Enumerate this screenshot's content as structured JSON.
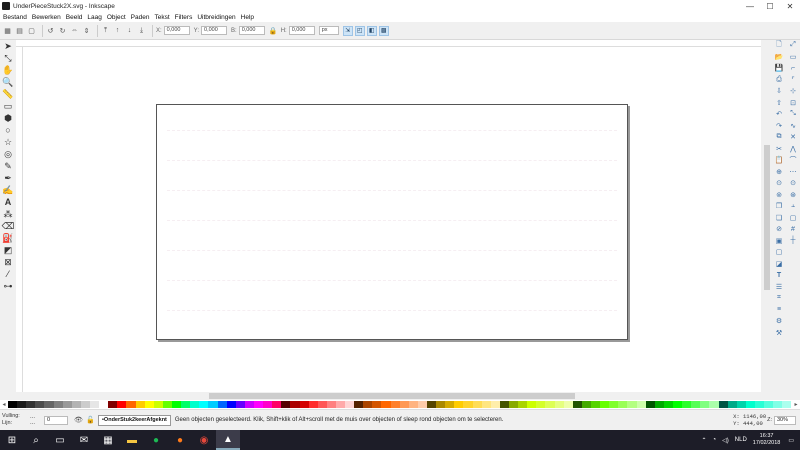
{
  "window": {
    "title": "UnderPieceStuck2X.svg - Inkscape",
    "minimize": "—",
    "maximize": "☐",
    "close": "✕"
  },
  "menu": [
    "Bestand",
    "Bewerken",
    "Beeld",
    "Laag",
    "Object",
    "Paden",
    "Tekst",
    "Filters",
    "Uitbreidingen",
    "Help"
  ],
  "toolcontrols": {
    "x_label": "X:",
    "x_value": "0,000",
    "y_label": "Y:",
    "y_value": "0,000",
    "w_label": "B:",
    "w_value": "0,000",
    "h_label": "H:",
    "h_value": "0,000",
    "unit": "px"
  },
  "statusbar": {
    "fill_label": "Vulling:",
    "stroke_label": "Lijn:",
    "fill_value": "...",
    "stroke_value": "...",
    "opacity": "0",
    "layer": "•OnderStuk2keerAfgeknt",
    "message": "Geen objecten geselecteerd. Klik, Shift+klik of Alt+scroll met de muis over objecten of sleep rond objecten om te selecteren.",
    "coord_x": "X: 1146,00",
    "coord_y": "Y:  444,00",
    "zoom_label": "Z:",
    "zoom": "30%"
  },
  "taskbar": {
    "language": "NLD",
    "time": "16:37",
    "date": "17/02/2018"
  },
  "palette_colors": [
    "#000000",
    "#1a1a1a",
    "#333333",
    "#4d4d4d",
    "#666666",
    "#808080",
    "#999999",
    "#b3b3b3",
    "#cccccc",
    "#e6e6e6",
    "#ffffff",
    "#800000",
    "#ff0000",
    "#ff6600",
    "#ffcc00",
    "#ffff00",
    "#ccff00",
    "#66ff00",
    "#00ff00",
    "#00ff66",
    "#00ffcc",
    "#00ffff",
    "#00ccff",
    "#0066ff",
    "#0000ff",
    "#6600ff",
    "#cc00ff",
    "#ff00ff",
    "#ff00cc",
    "#ff0066",
    "#550000",
    "#aa0000",
    "#d40000",
    "#ff2a2a",
    "#ff5555",
    "#ff8080",
    "#ffaaaa",
    "#ffd5d5",
    "#552200",
    "#aa4400",
    "#d45500",
    "#ff6600",
    "#ff7f2a",
    "#ff9955",
    "#ffb380",
    "#ffccaa",
    "#554400",
    "#aa8800",
    "#d4aa00",
    "#ffcc00",
    "#ffd42a",
    "#ffdd55",
    "#ffe680",
    "#ffeeaa",
    "#445500",
    "#88aa00",
    "#aad400",
    "#ccff00",
    "#d4ff2a",
    "#ddff55",
    "#e5ff80",
    "#eeffaa",
    "#225500",
    "#44aa00",
    "#55d400",
    "#66ff00",
    "#7fff2a",
    "#99ff55",
    "#b3ff80",
    "#ccffaa",
    "#005500",
    "#00aa00",
    "#00d400",
    "#00ff00",
    "#2aff2a",
    "#55ff55",
    "#80ff80",
    "#aaffaa",
    "#005544",
    "#00aa88",
    "#00d4aa",
    "#00ffcc",
    "#2affd5",
    "#55ffdd",
    "#80ffe6",
    "#aaffee"
  ]
}
